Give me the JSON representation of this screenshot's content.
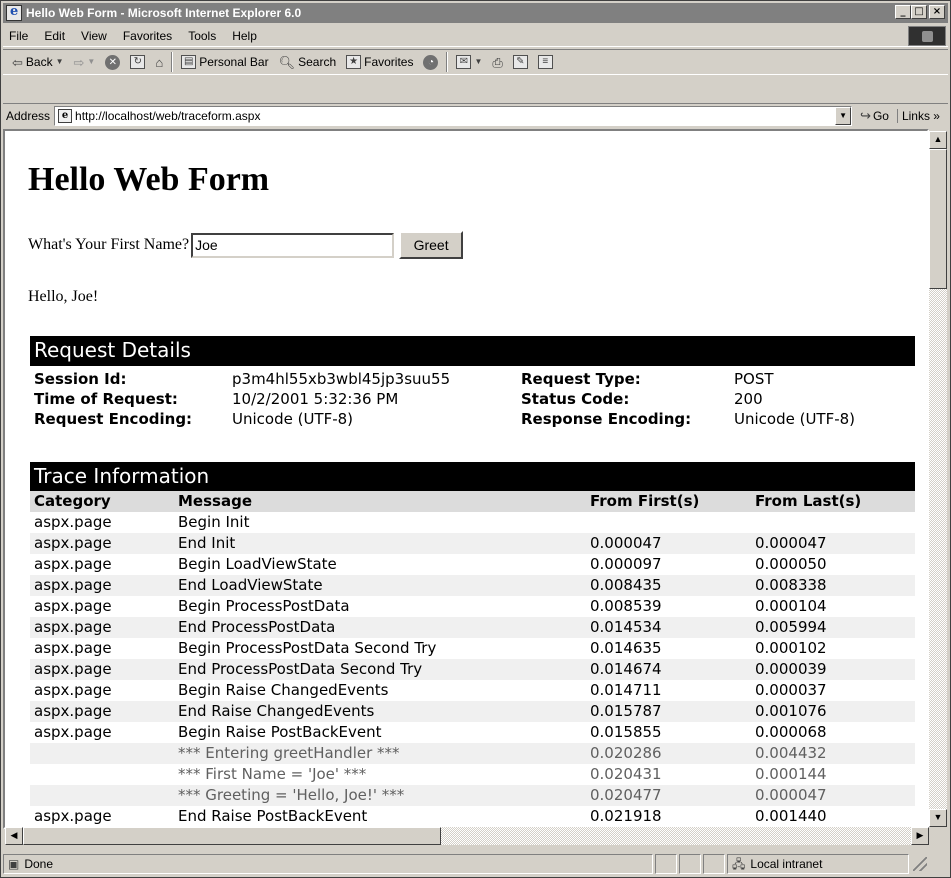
{
  "window": {
    "title": "Hello Web Form - Microsoft Internet Explorer 6.0",
    "controls": [
      "_",
      "□",
      "×"
    ]
  },
  "menu": [
    "File",
    "Edit",
    "View",
    "Favorites",
    "Tools",
    "Help"
  ],
  "toolbar": {
    "back_label": "Back",
    "personal_bar_label": "Personal Bar",
    "search_label": "Search",
    "favorites_label": "Favorites"
  },
  "address": {
    "label": "Address",
    "url": "http://localhost/web/traceform.aspx",
    "go_label": "Go",
    "links_label": "Links »"
  },
  "page": {
    "heading": "Hello Web Form",
    "prompt": "What's Your First Name?",
    "name_value": "Joe",
    "greet_button": "Greet",
    "greeting": "Hello, Joe!"
  },
  "request_details": {
    "title": "Request Details",
    "rows": [
      {
        "k1": "Session Id:",
        "v1": "p3m4hl55xb3wbl45jp3suu55",
        "k2": "Request Type:",
        "v2": "POST"
      },
      {
        "k1": "Time of Request:",
        "v1": "10/2/2001 5:32:36 PM",
        "k2": "Status Code:",
        "v2": "200"
      },
      {
        "k1": "Request Encoding:",
        "v1": "Unicode (UTF-8)",
        "k2": "Response Encoding:",
        "v2": "Unicode (UTF-8)"
      }
    ]
  },
  "trace": {
    "title": "Trace Information",
    "headers": [
      "Category",
      "Message",
      "From First(s)",
      "From Last(s)"
    ],
    "rows": [
      [
        "aspx.page",
        "Begin Init",
        "",
        ""
      ],
      [
        "aspx.page",
        "End Init",
        "0.000047",
        "0.000047"
      ],
      [
        "aspx.page",
        "Begin LoadViewState",
        "0.000097",
        "0.000050"
      ],
      [
        "aspx.page",
        "End LoadViewState",
        "0.008435",
        "0.008338"
      ],
      [
        "aspx.page",
        "Begin ProcessPostData",
        "0.008539",
        "0.000104"
      ],
      [
        "aspx.page",
        "End ProcessPostData",
        "0.014534",
        "0.005994"
      ],
      [
        "aspx.page",
        "Begin ProcessPostData Second Try",
        "0.014635",
        "0.000102"
      ],
      [
        "aspx.page",
        "End ProcessPostData Second Try",
        "0.014674",
        "0.000039"
      ],
      [
        "aspx.page",
        "Begin Raise ChangedEvents",
        "0.014711",
        "0.000037"
      ],
      [
        "aspx.page",
        "End Raise ChangedEvents",
        "0.015787",
        "0.001076"
      ],
      [
        "aspx.page",
        "Begin Raise PostBackEvent",
        "0.015855",
        "0.000068"
      ],
      [
        "",
        "*** Entering greetHandler ***",
        "0.020286",
        "0.004432"
      ],
      [
        "",
        "*** First Name = 'Joe' ***",
        "0.020431",
        "0.000144"
      ],
      [
        "",
        "*** Greeting = 'Hello, Joe!' ***",
        "0.020477",
        "0.000047"
      ],
      [
        "aspx.page",
        "End Raise PostBackEvent",
        "0.021918",
        "0.001440"
      ]
    ]
  },
  "status": {
    "text": "Done",
    "zone": "Local intranet"
  }
}
